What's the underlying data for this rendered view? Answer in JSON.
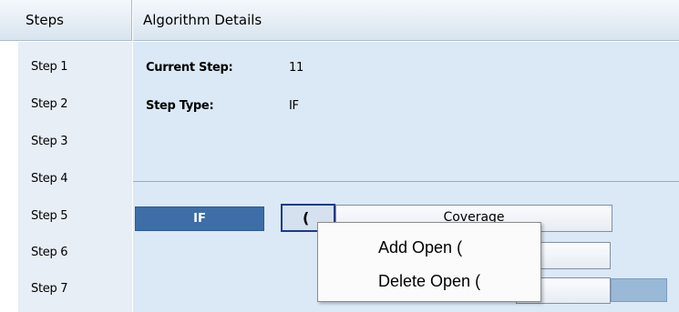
{
  "header": {
    "steps_title": "Steps",
    "details_title": "Algorithm Details"
  },
  "steps": {
    "items": [
      {
        "label": "Step 1"
      },
      {
        "label": "Step 2"
      },
      {
        "label": "Step 3"
      },
      {
        "label": "Step 4"
      },
      {
        "label": "Step 5"
      },
      {
        "label": "Step 6"
      },
      {
        "label": "Step 7"
      }
    ]
  },
  "details": {
    "current_step_label": "Current Step:",
    "current_step_value": "11",
    "step_type_label": "Step Type:",
    "step_type_value": "IF"
  },
  "expression": {
    "if_label": "IF",
    "paren_label": "(",
    "field_value": "Coverage"
  },
  "context_menu": {
    "items": [
      {
        "label": "Add Open ("
      },
      {
        "label": "Delete Open ("
      }
    ]
  },
  "colors": {
    "header_border": "#a9bccf",
    "details_bg": "#dbe8f5",
    "if_bg": "#3e6ea7",
    "paren_border": "#1f3a88"
  }
}
